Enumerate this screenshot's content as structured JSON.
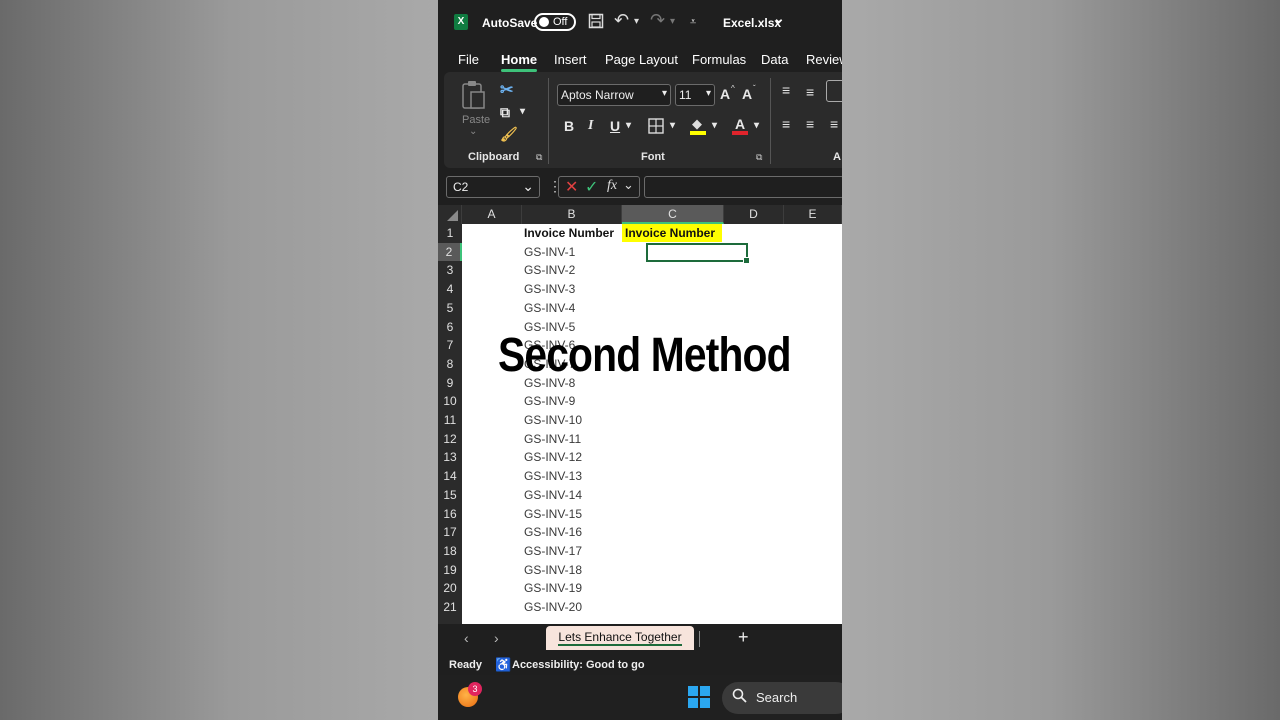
{
  "titlebar": {
    "autosave_label": "AutoSave",
    "toggle_state": "Off",
    "filename": "Excel.xlsx",
    "chevron": "⌄"
  },
  "menu": {
    "tabs": [
      "File",
      "Home",
      "Insert",
      "Page Layout",
      "Formulas",
      "Data",
      "Review"
    ],
    "active": "Home"
  },
  "ribbon": {
    "paste_label": "Paste",
    "clipboard_label": "Clipboard",
    "font_label": "Font",
    "alignment_label": "A",
    "font_name": "Aptos Narrow",
    "font_size": "11",
    "bold": "B",
    "italic": "I",
    "underline": "U",
    "grow_font": "A",
    "shrink_font": "A",
    "font_color_letter": "A",
    "highlight_color": "#ffff00",
    "font_color": "#e0242c"
  },
  "formula_bar": {
    "name_box": "C2",
    "fx": "fx",
    "value": ""
  },
  "grid": {
    "columns": [
      "A",
      "B",
      "C",
      "D",
      "E"
    ],
    "selected_column": "C",
    "rows": [
      "1",
      "2",
      "3",
      "4",
      "5",
      "6",
      "7",
      "8",
      "9",
      "10",
      "11",
      "12",
      "13",
      "14",
      "15",
      "16",
      "17",
      "18",
      "19",
      "20",
      "21"
    ],
    "selected_row": "2",
    "header_b": "Invoice Number",
    "header_c": "Invoice Number",
    "column_b": [
      "GS-INV-1",
      "GS-INV-2",
      "GS-INV-3",
      "GS-INV-4",
      "GS-INV-5",
      "GS-INV-6",
      "GS-INV-7",
      "GS-INV-8",
      "GS-INV-9",
      "GS-INV-10",
      "GS-INV-11",
      "GS-INV-12",
      "GS-INV-13",
      "GS-INV-14",
      "GS-INV-15",
      "GS-INV-16",
      "GS-INV-17",
      "GS-INV-18",
      "GS-INV-19",
      "GS-INV-20"
    ]
  },
  "overlay_text": "Second Method",
  "sheet_tabs": {
    "active_tab": "Lets Enhance Together",
    "add": "+"
  },
  "statusbar": {
    "ready": "Ready",
    "accessibility": "Accessibility: Good to go"
  },
  "taskbar": {
    "notification_count": "3",
    "search_label": "Search"
  },
  "colors": {
    "excel_green": "#107c41",
    "accent_green": "#3ec27a",
    "yellow_fill": "#ffff00",
    "cancel_red": "#e04040"
  }
}
